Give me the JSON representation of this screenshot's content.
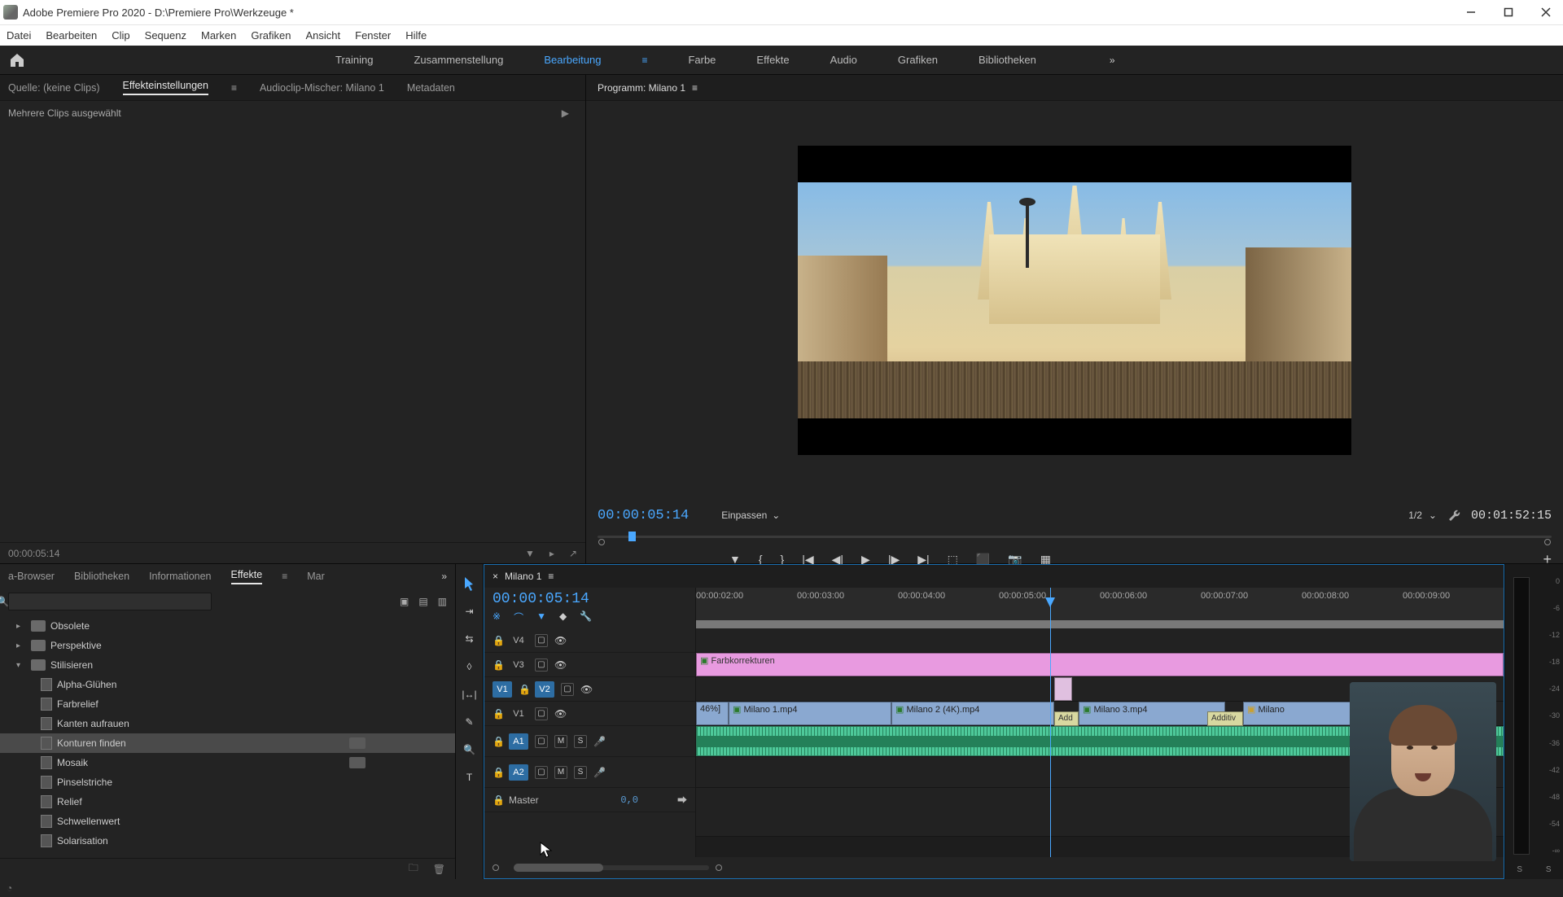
{
  "window": {
    "title": "Adobe Premiere Pro 2020 - D:\\Premiere Pro\\Werkzeuge *"
  },
  "menu": [
    "Datei",
    "Bearbeiten",
    "Clip",
    "Sequenz",
    "Marken",
    "Grafiken",
    "Ansicht",
    "Fenster",
    "Hilfe"
  ],
  "workspaces": {
    "tabs": [
      "Training",
      "Zusammenstellung",
      "Bearbeitung",
      "Farbe",
      "Effekte",
      "Audio",
      "Grafiken",
      "Bibliotheken"
    ],
    "active": 2
  },
  "source_tabs": {
    "items": [
      "Quelle: (keine Clips)",
      "Effekteinstellungen",
      "Audioclip-Mischer: Milano 1",
      "Metadaten"
    ],
    "active": 1,
    "info": "Mehrere Clips ausgewählt",
    "footer_time": "00:00:05:14"
  },
  "program": {
    "title": "Programm: Milano 1",
    "timecode": "00:00:05:14",
    "fit": "Einpassen",
    "res": "1/2",
    "duration": "00:01:52:15"
  },
  "effects": {
    "tabs": [
      "a-Browser",
      "Bibliotheken",
      "Informationen",
      "Effekte",
      "Mar"
    ],
    "active": 3,
    "folders": [
      {
        "name": "Obsolete",
        "open": false,
        "depth": 0
      },
      {
        "name": "Perspektive",
        "open": false,
        "depth": 0
      },
      {
        "name": "Stilisieren",
        "open": true,
        "depth": 0
      }
    ],
    "items": [
      {
        "name": "Alpha-Glühen",
        "badge": false,
        "sel": false
      },
      {
        "name": "Farbrelief",
        "badge": false,
        "sel": false
      },
      {
        "name": "Kanten aufrauen",
        "badge": false,
        "sel": false
      },
      {
        "name": "Konturen finden",
        "badge": true,
        "sel": true
      },
      {
        "name": "Mosaik",
        "badge": true,
        "sel": false
      },
      {
        "name": "Pinselstriche",
        "badge": false,
        "sel": false
      },
      {
        "name": "Relief",
        "badge": false,
        "sel": false
      },
      {
        "name": "Schwellenwert",
        "badge": false,
        "sel": false
      },
      {
        "name": "Solarisation",
        "badge": false,
        "sel": false
      }
    ]
  },
  "timeline": {
    "title": "Milano 1",
    "timecode": "00:00:05:14",
    "ruler": [
      "00:00:02:00",
      "00:00:03:00",
      "00:00:04:00",
      "00:00:05:00",
      "00:00:06:00",
      "00:00:07:00",
      "00:00:08:00",
      "00:00:09:00"
    ],
    "tracks": {
      "v4": "V4",
      "v3": "V3",
      "v2": "V2",
      "v1": "V1",
      "a1": "A1",
      "a2": "A2",
      "master": "Master",
      "master_val": "0,0",
      "src_v": "V1",
      "src_a": "A1"
    },
    "clips": {
      "adj": "Farbkorrekturen",
      "v1a": "46%]",
      "v1b": "Milano 1.mp4",
      "v1c": "Milano 2 (4K).mp4",
      "v1d": "Milano 3.mp4",
      "v1e": "Milano",
      "trans1": "Add",
      "trans2": "Additiv"
    }
  },
  "meters": {
    "ticks": [
      "0",
      "-6",
      "-12",
      "-18",
      "-24",
      "-30",
      "-36",
      "-42",
      "-48",
      "-54",
      "-∞"
    ],
    "s": "S"
  }
}
